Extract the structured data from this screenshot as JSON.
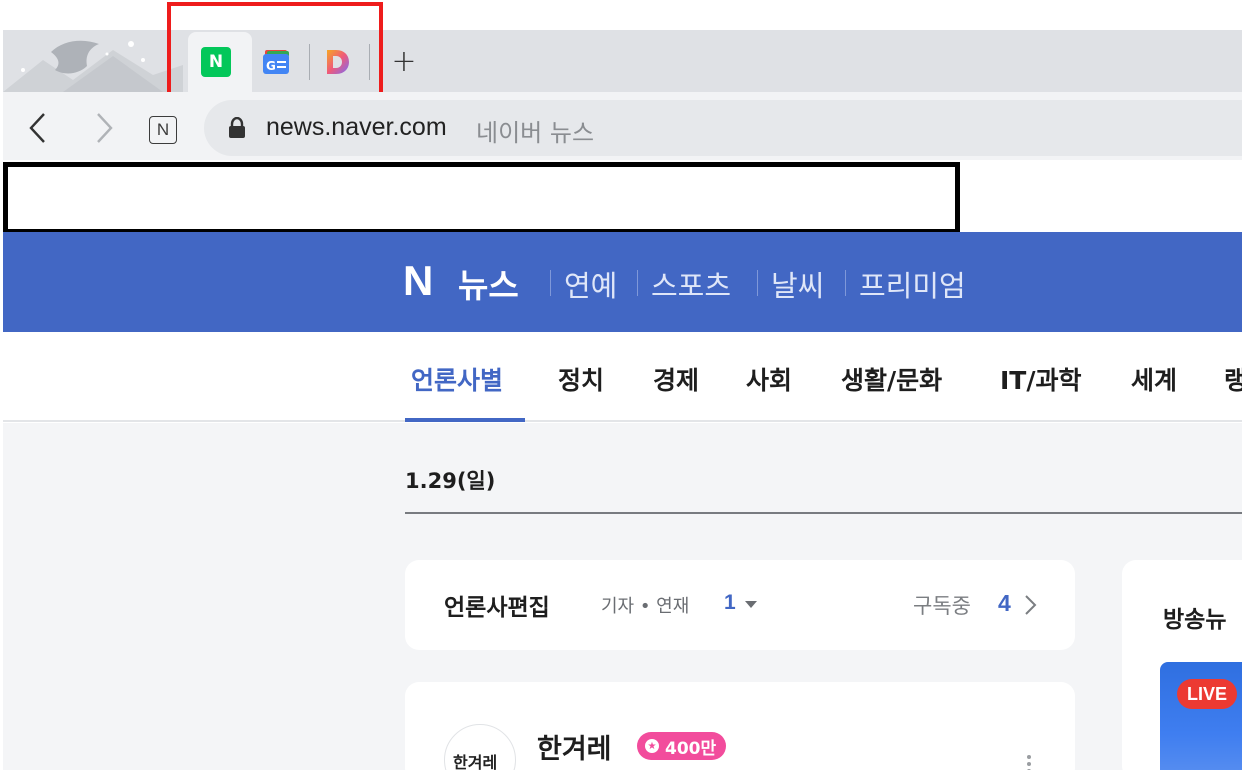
{
  "browser": {
    "tabs": [
      {
        "icon": "naver-icon",
        "letter": "N",
        "active": true
      },
      {
        "icon": "google-news-icon",
        "letter": "G",
        "active": false
      },
      {
        "icon": "d-app-icon",
        "letter": "D",
        "active": false
      }
    ],
    "new_tab_label": "+",
    "url_host": "news.naver.com",
    "page_title": "네이버 뉴스",
    "site_button_letter": "N"
  },
  "header": {
    "brand_letter": "N",
    "brand_name": "뉴스",
    "links": [
      "연예",
      "스포츠",
      "날씨",
      "프리미엄"
    ]
  },
  "categories": {
    "items": [
      "언론사별",
      "정치",
      "경제",
      "사회",
      "생활/문화",
      "IT/과학",
      "세계",
      "랭"
    ],
    "active_index": 0
  },
  "content": {
    "date": "1.29(일)",
    "press_edit": {
      "title": "언론사편집",
      "filter_label": "기자 • 연재",
      "filter_count": "1",
      "subscribed_label": "구독중",
      "subscribed_count": "4"
    },
    "press_card": {
      "logo_text": "한겨레",
      "name": "한겨레",
      "badge": "400만"
    },
    "broadcast": {
      "title": "방송뉴",
      "live_label": "LIVE"
    }
  },
  "colors": {
    "naver_blue": "#4267c4",
    "naver_green": "#03c75a",
    "highlight_red": "#ee1c1c",
    "badge_pink": "#f24c9c",
    "live_red": "#ec3a32"
  }
}
